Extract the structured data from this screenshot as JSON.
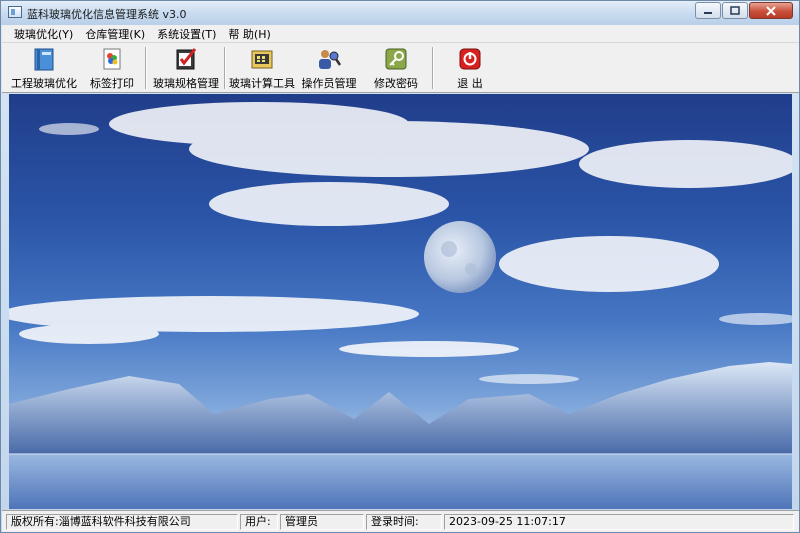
{
  "window": {
    "title": "蓝科玻璃优化信息管理系统 v3.0"
  },
  "menu": [
    {
      "label": "玻璃优化(Y)"
    },
    {
      "label": "仓库管理(K)"
    },
    {
      "label": "系统设置(T)"
    },
    {
      "label": "帮 助(H)"
    }
  ],
  "toolbar": [
    {
      "label": "工程玻璃优化",
      "icon": "book-icon"
    },
    {
      "label": "标签打印",
      "icon": "print-label-icon"
    },
    {
      "label": "玻璃规格管理",
      "icon": "spec-check-icon"
    },
    {
      "label": "玻璃计算工具",
      "icon": "calculator-icon"
    },
    {
      "label": "操作员管理",
      "icon": "users-icon"
    },
    {
      "label": "修改密码",
      "icon": "key-icon"
    },
    {
      "label": "退 出",
      "icon": "exit-icon"
    }
  ],
  "status": {
    "copyright_label": "版权所有:",
    "company": "淄博蓝科软件科技有限公司",
    "user_label": "用户:",
    "user": "管理员",
    "login_label": "登录时间:",
    "login_time": "2023-09-25  11:07:17"
  }
}
